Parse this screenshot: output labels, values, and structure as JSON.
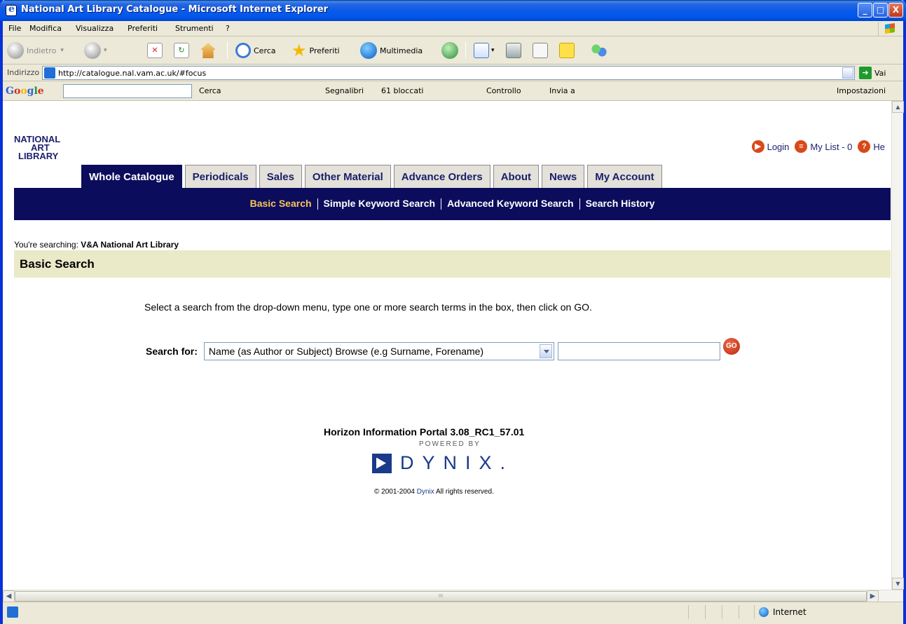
{
  "window": {
    "title": "National Art Library Catalogue - Microsoft Internet Explorer",
    "minimize": "_",
    "maximize": "□",
    "close": "X"
  },
  "menu": [
    "File",
    "Modifica",
    "Visualizza",
    "Preferiti",
    "Strumenti",
    "?"
  ],
  "toolbar": {
    "back": "Indietro",
    "search": "Cerca",
    "favorites": "Preferiti",
    "media": "Multimedia"
  },
  "address": {
    "label": "Indirizzo",
    "url": "http://catalogue.nal.vam.ac.uk/#focus",
    "go": "Vai"
  },
  "google": {
    "logo": "Google",
    "search": "Cerca",
    "bookmarks": "Segnalibri",
    "blocked": "61 bloccati",
    "spell": "Controllo",
    "send": "Invia a",
    "settings": "Impostazioni"
  },
  "site": {
    "logo": [
      "NATIONAL",
      "ART",
      "LIBRARY"
    ],
    "toplinks": {
      "login": "Login",
      "mylist": "My List - 0",
      "help": "He"
    },
    "tabs": [
      {
        "label": "Whole Catalogue",
        "active": true
      },
      {
        "label": "Periodicals",
        "active": false
      },
      {
        "label": "Sales",
        "active": false
      },
      {
        "label": "Other Material",
        "active": false
      },
      {
        "label": "Advance Orders",
        "active": false
      },
      {
        "label": "About",
        "active": false
      },
      {
        "label": "News",
        "active": false
      },
      {
        "label": "My Account",
        "active": false
      }
    ],
    "subnav": {
      "basic": "Basic Search",
      "simple": "Simple Keyword Search",
      "advanced": "Advanced Keyword Search",
      "history": "Search History"
    },
    "searching_prefix": "You're searching:",
    "searching_value": "V&A National Art Library",
    "heading": "Basic Search",
    "instructions": "Select a search from the drop-down menu, type one or more search terms in the box, then click on GO.",
    "search": {
      "label": "Search for:",
      "selected": "Name (as Author or Subject) Browse (e.g Surname, Forename)",
      "value": "",
      "go": "GO"
    },
    "footer": {
      "portal": "Horizon Information Portal 3.08_RC1_57.01",
      "powered": "POWERED BY",
      "brand": "DYNIX.",
      "copyright_prefix": "© 2001-2004",
      "copyright_link": "Dynix",
      "copyright_suffix": "All rights reserved."
    }
  },
  "status": {
    "zone": "Internet",
    "hscroll_grip": "III"
  }
}
